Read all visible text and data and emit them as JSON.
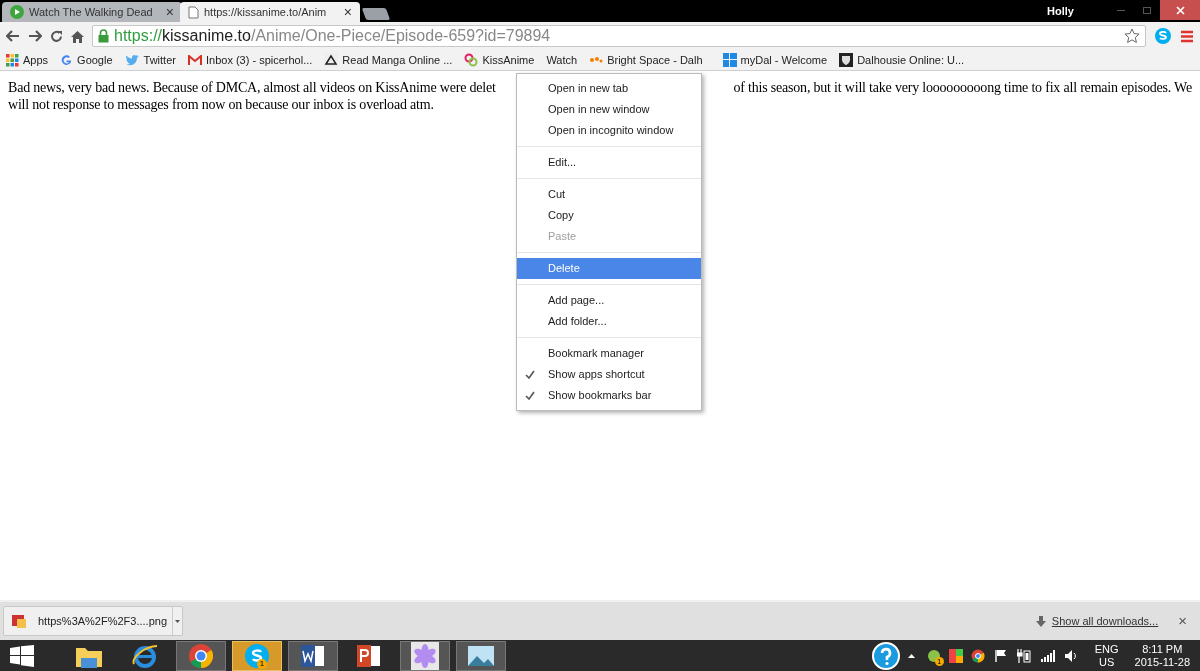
{
  "window": {
    "user": "Holly"
  },
  "tabs": [
    {
      "title": "Watch The Walking Dead",
      "selected": false,
      "close": "×"
    },
    {
      "title": "https://kissanime.to/Anim",
      "selected": true,
      "close": "×"
    }
  ],
  "address_bar": {
    "scheme": "https://",
    "host": "kissanime.to",
    "path": "/Anime/One-Piece/Episode-659?id=79894"
  },
  "bookmarks": [
    {
      "label": "Apps",
      "kind": "apps"
    },
    {
      "label": "Google",
      "kind": "google"
    },
    {
      "label": "Twitter",
      "kind": "twitter"
    },
    {
      "label": "Inbox (3) - spicerhol...",
      "kind": "gmail"
    },
    {
      "label": "Read Manga Online ...",
      "kind": "manga"
    },
    {
      "label": "KissAnime",
      "kind": "kiss"
    },
    {
      "label": "Watch",
      "kind": "plain"
    },
    {
      "label": "Bright Space - Dalh",
      "kind": "bright"
    },
    {
      "label": "myDal - Welcome",
      "kind": "windows"
    },
    {
      "label": "Dalhousie Online: U...",
      "kind": "shield"
    }
  ],
  "page": {
    "line_1_left": "Bad news, very bad news. Because of DMCA, almost all videos on KissAnime were delet",
    "line_1_right": "of this season, but it will take very looooooooong time to fix all remain episodes. We",
    "line_2": "will not response to messages from now on because our inbox is overload atm."
  },
  "context_menu": [
    {
      "kind": "item",
      "label": "Open in new tab",
      "disabled": false,
      "selected": false,
      "checked": false
    },
    {
      "kind": "item",
      "label": "Open in new window",
      "disabled": false,
      "selected": false,
      "checked": false
    },
    {
      "kind": "item",
      "label": "Open in incognito window",
      "disabled": false,
      "selected": false,
      "checked": false
    },
    {
      "kind": "separator"
    },
    {
      "kind": "item",
      "label": "Edit...",
      "disabled": false,
      "selected": false,
      "checked": false
    },
    {
      "kind": "separator"
    },
    {
      "kind": "item",
      "label": "Cut",
      "disabled": false,
      "selected": false,
      "checked": false
    },
    {
      "kind": "item",
      "label": "Copy",
      "disabled": false,
      "selected": false,
      "checked": false
    },
    {
      "kind": "item",
      "label": "Paste",
      "disabled": true,
      "selected": false,
      "checked": false
    },
    {
      "kind": "separator"
    },
    {
      "kind": "item",
      "label": "Delete",
      "disabled": false,
      "selected": true,
      "checked": false
    },
    {
      "kind": "separator"
    },
    {
      "kind": "item",
      "label": "Add page...",
      "disabled": false,
      "selected": false,
      "checked": false
    },
    {
      "kind": "item",
      "label": "Add folder...",
      "disabled": false,
      "selected": false,
      "checked": false
    },
    {
      "kind": "separator"
    },
    {
      "kind": "item",
      "label": "Bookmark manager",
      "disabled": false,
      "selected": false,
      "checked": false
    },
    {
      "kind": "item",
      "label": "Show apps shortcut",
      "disabled": false,
      "selected": false,
      "checked": true
    },
    {
      "kind": "item",
      "label": "Show bookmarks bar",
      "disabled": false,
      "selected": false,
      "checked": true
    }
  ],
  "download_shelf": {
    "file": "https%3A%2F%2F3....png",
    "show_all": "Show all downloads...",
    "close": "×"
  },
  "taskbar": {
    "apps": [
      {
        "kind": "explorer",
        "active": false
      },
      {
        "kind": "ie",
        "active": false
      },
      {
        "kind": "chrome",
        "active": true
      },
      {
        "kind": "skype",
        "active": true,
        "badge": "1"
      },
      {
        "kind": "word",
        "active": true
      },
      {
        "kind": "powerpoint",
        "active": false
      },
      {
        "kind": "flower",
        "active": true
      },
      {
        "kind": "photos",
        "active": true
      }
    ],
    "tray_badge": "1",
    "language": "ENG",
    "region": "US",
    "time": "8:11 PM",
    "date": "2015-11-28"
  }
}
